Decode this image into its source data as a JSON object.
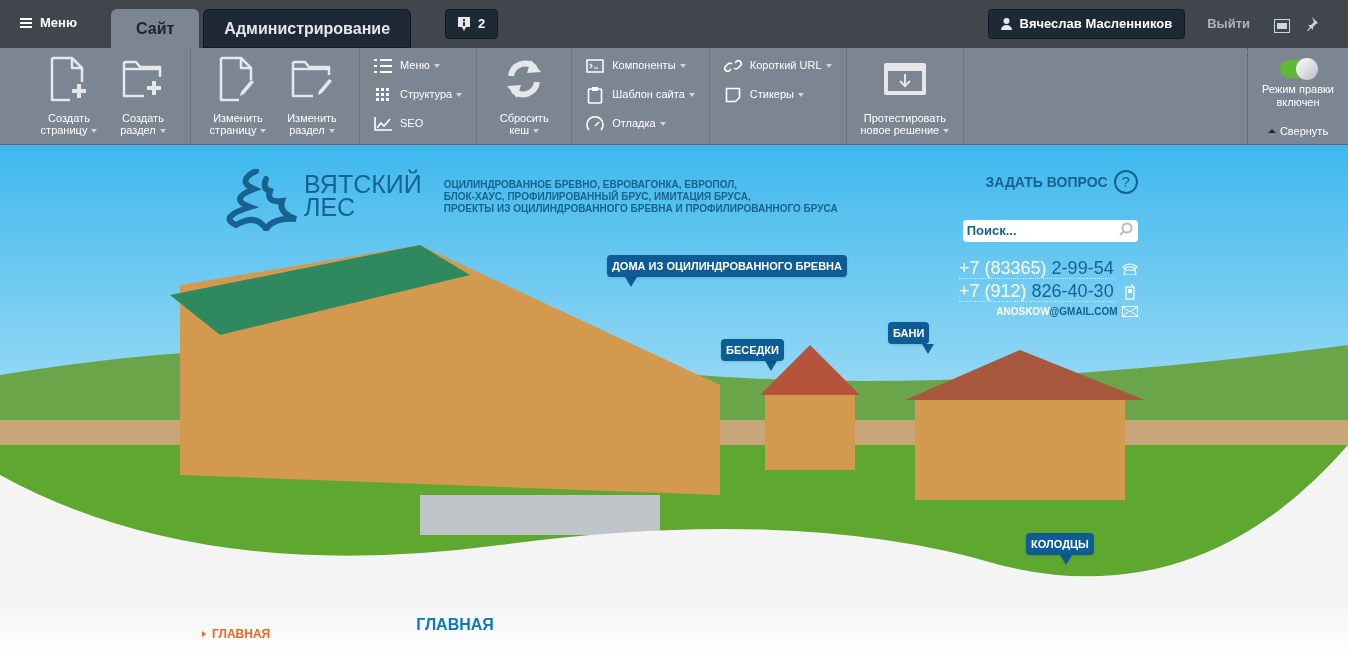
{
  "admin_bar": {
    "menu_label": "Меню",
    "tabs": [
      {
        "label": "Сайт",
        "selected": true
      },
      {
        "label": "Администрирование",
        "selected": false
      }
    ],
    "notifications": "2",
    "user": "Вячеслав Масленников",
    "logout": "Выйти"
  },
  "toolbar": {
    "groups": [
      {
        "kind": "big",
        "items": [
          {
            "label": "Создать\nстраницу",
            "dropdown": true
          },
          {
            "label": "Создать\nраздел",
            "dropdown": true
          }
        ]
      },
      {
        "kind": "big",
        "items": [
          {
            "label": "Изменить\nстраницу",
            "dropdown": true
          },
          {
            "label": "Изменить\nраздел",
            "dropdown": true
          }
        ]
      },
      {
        "kind": "list",
        "items": [
          {
            "label": "Меню",
            "dropdown": true
          },
          {
            "label": "Структура",
            "dropdown": true
          },
          {
            "label": "SEO",
            "dropdown": false
          }
        ]
      },
      {
        "kind": "big",
        "items": [
          {
            "label": "Сбросить\nкеш",
            "dropdown": true
          }
        ]
      },
      {
        "kind": "list",
        "items": [
          {
            "label": "Компоненты",
            "dropdown": true
          },
          {
            "label": "Шаблон сайта",
            "dropdown": true
          },
          {
            "label": "Отладка",
            "dropdown": true
          }
        ]
      },
      {
        "kind": "list",
        "items": [
          {
            "label": "Короткий URL",
            "dropdown": true
          },
          {
            "label": "Стикеры",
            "dropdown": true
          }
        ]
      },
      {
        "kind": "big",
        "items": [
          {
            "label": "Протестировать\nновое решение",
            "dropdown": true
          }
        ]
      }
    ],
    "edit_mode": {
      "on": true,
      "label": "Режим правки\nвключен"
    },
    "collapse": "Свернуть"
  },
  "site": {
    "logo": [
      "ВЯТСКИЙ",
      "ЛЕС"
    ],
    "tagline": [
      "ОЦИЛИНДРОВАННОЕ БРЕВНО, ЕВРОВАГОНКА, ЕВРОПОЛ,",
      "БЛОК-ХАУС, ПРОФИЛИРОВАННЫЙ БРУС, ИМИТАЦИЯ БРУСА,",
      "ПРОЕКТЫ ИЗ ОЦИЛИНДРОВАННОГО БРЕВНА И ПРОФИЛИРОВАННОГО БРУСА"
    ],
    "ask": "ЗАДАТЬ ВОПРОС",
    "ask_glyph": "?",
    "search": {
      "placeholder": "Поиск..."
    },
    "phones": [
      {
        "kind": "landline",
        "code": "+7 (83365)",
        "number": "2-99-54"
      },
      {
        "kind": "mobile",
        "code": "+7 (912)",
        "number": "826-40-30"
      }
    ],
    "email": {
      "user": "ANOSKOW",
      "domain": "@GMAIL.COM"
    },
    "callouts": [
      {
        "label": "ДОМА ИЗ ОЦИЛИНДРОВАННОГО БРЕВНА"
      },
      {
        "label": "БЕСЕДКИ"
      },
      {
        "label": "БАНИ"
      },
      {
        "label": "КОЛОДЦЫ"
      }
    ],
    "nav": [
      {
        "label": "ГЛАВНАЯ",
        "selected": true
      }
    ],
    "page_title": "ГЛАВНАЯ"
  }
}
